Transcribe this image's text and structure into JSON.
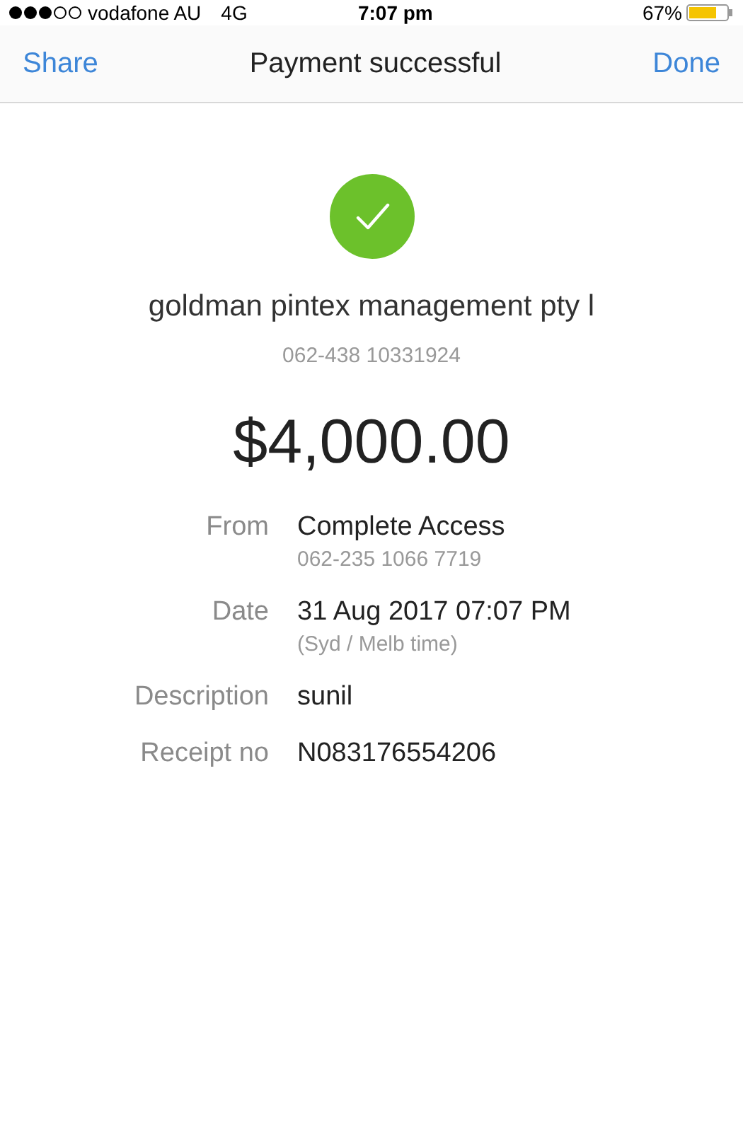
{
  "status_bar": {
    "carrier": "vodafone AU",
    "network": "4G",
    "time": "7:07 pm",
    "battery": "67%"
  },
  "nav": {
    "left": "Share",
    "title": "Payment successful",
    "right": "Done"
  },
  "payee": {
    "name": "goldman pintex management pty l",
    "account": "062-438 10331924"
  },
  "amount": "$4,000.00",
  "details": [
    {
      "label": "From",
      "value": "Complete Access",
      "sub": "062-235 1066 7719"
    },
    {
      "label": "Date",
      "value": "31 Aug 2017 07:07 PM",
      "sub": "(Syd / Melb time)"
    },
    {
      "label": "Description",
      "value": "sunil"
    },
    {
      "label": "Receipt no",
      "value": "N083176554206"
    }
  ]
}
